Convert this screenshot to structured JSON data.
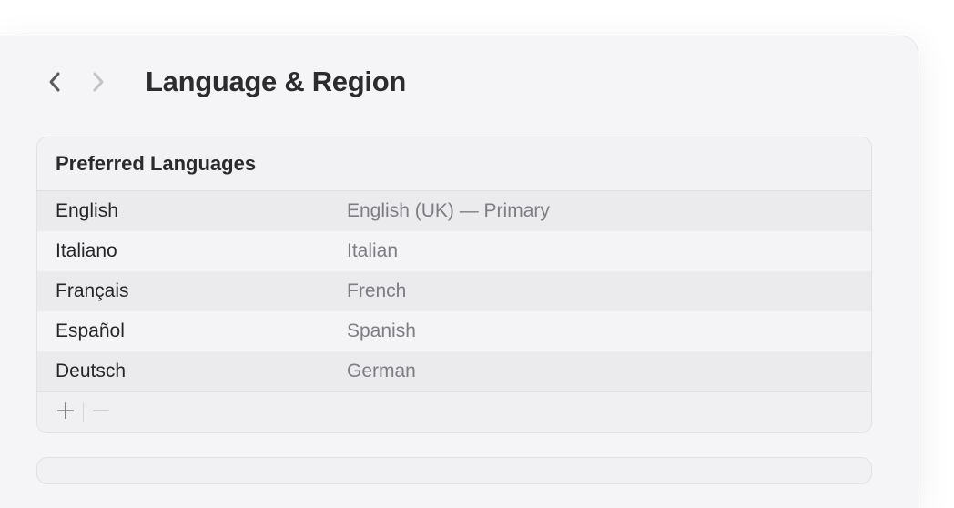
{
  "header": {
    "title": "Language & Region"
  },
  "preferred_languages": {
    "section_title": "Preferred Languages",
    "items": [
      {
        "native": "English",
        "description": "English (UK) — Primary"
      },
      {
        "native": "Italiano",
        "description": "Italian"
      },
      {
        "native": "Français",
        "description": "French"
      },
      {
        "native": "Español",
        "description": "Spanish"
      },
      {
        "native": "Deutsch",
        "description": "German"
      }
    ]
  }
}
